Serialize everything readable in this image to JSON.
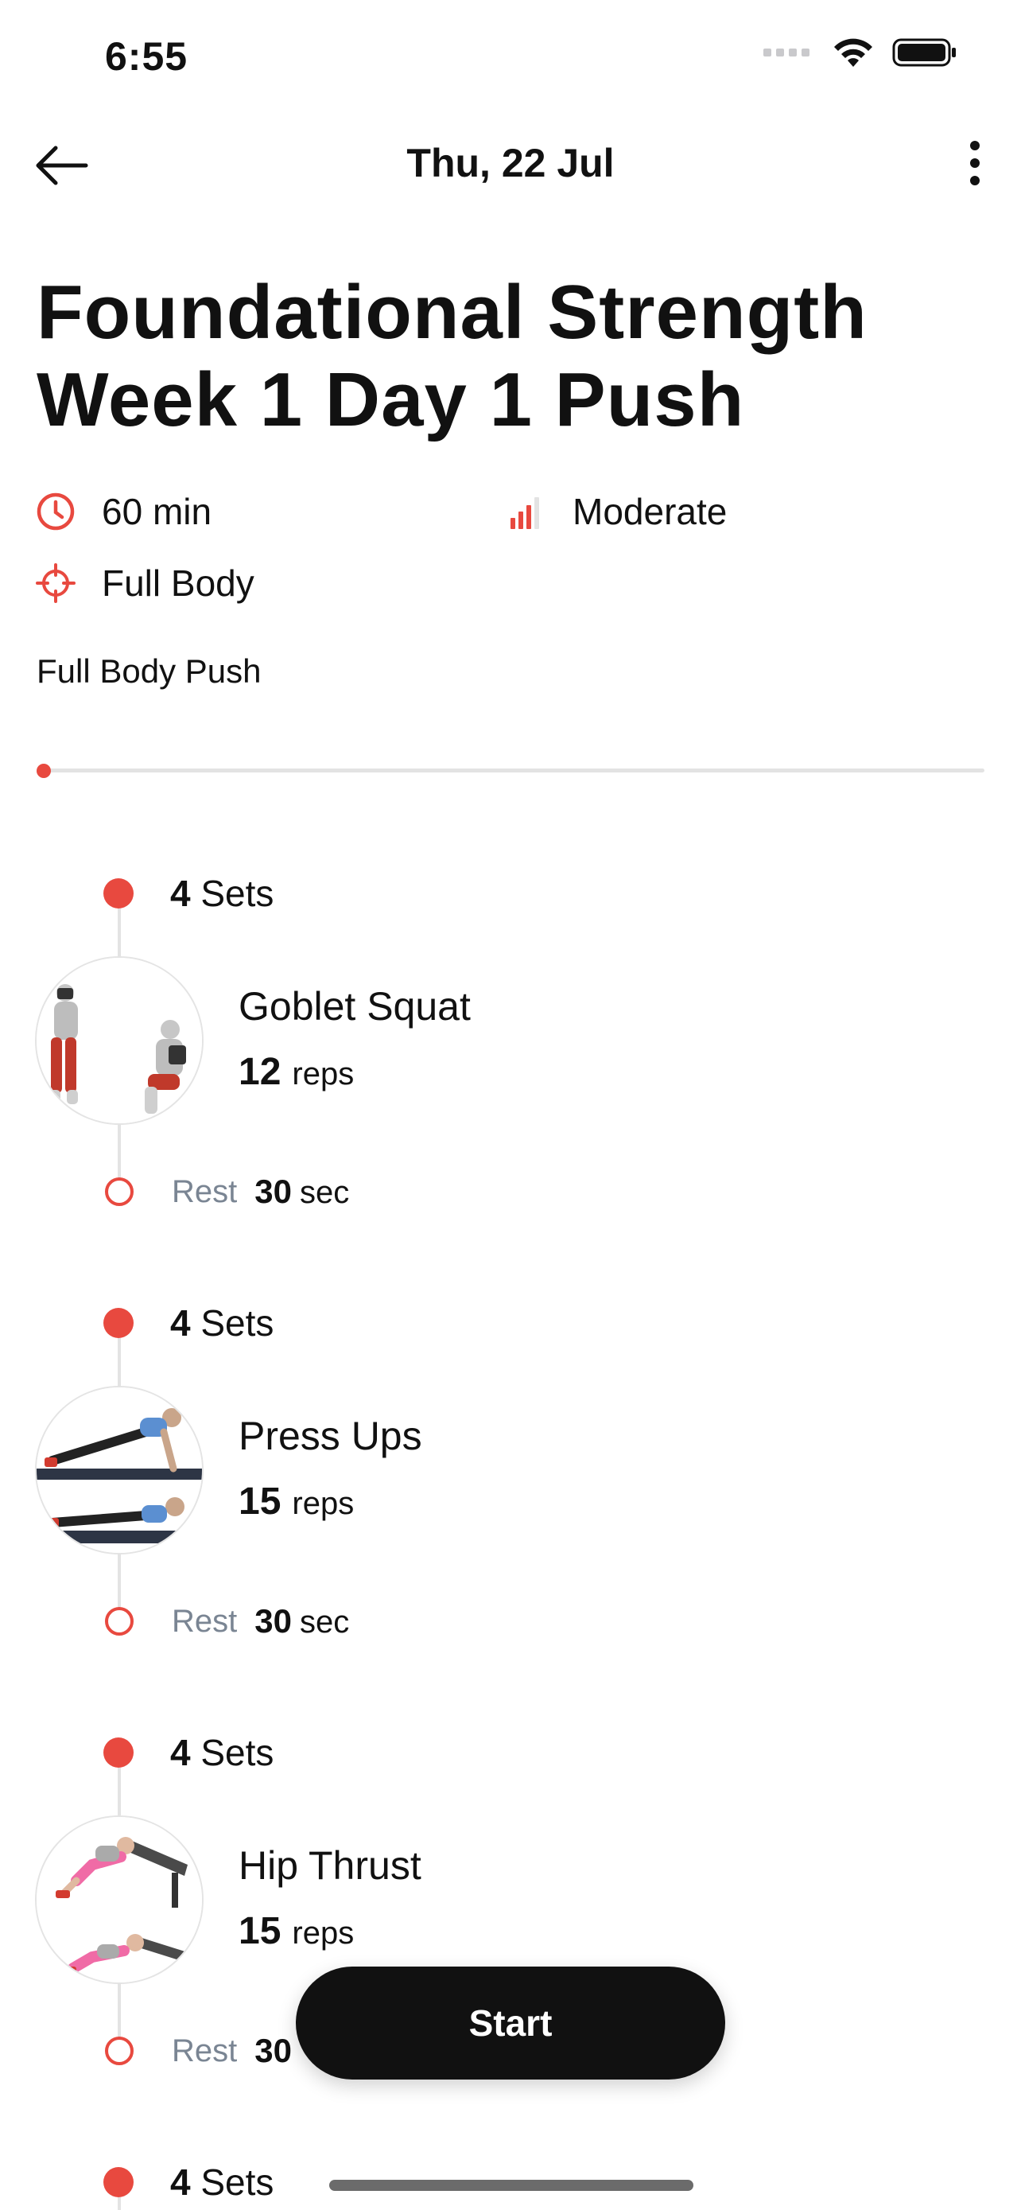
{
  "status_bar": {
    "time": "6:55"
  },
  "nav": {
    "title": "Thu, 22 Jul"
  },
  "workout": {
    "title_line1": "Foundational Strength",
    "title_line2": "Week 1 Day 1 Push",
    "duration": "60 min",
    "intensity": "Moderate",
    "focus": "Full Body",
    "description": "Full Body Push",
    "progress_fraction": 0.0
  },
  "exercises": [
    {
      "sets_count": "4",
      "sets_label": "Sets",
      "name": "Goblet Squat",
      "reps_count": "12",
      "reps_label": "reps",
      "rest_label": "Rest",
      "rest_value": "30",
      "rest_unit": "sec"
    },
    {
      "sets_count": "4",
      "sets_label": "Sets",
      "name": "Press Ups",
      "reps_count": "15",
      "reps_label": "reps",
      "rest_label": "Rest",
      "rest_value": "30",
      "rest_unit": "sec"
    },
    {
      "sets_count": "4",
      "sets_label": "Sets",
      "name": "Hip Thrust",
      "reps_count": "15",
      "reps_label": "reps",
      "rest_label": "Rest",
      "rest_value": "30",
      "rest_unit": ""
    },
    {
      "sets_count": "4",
      "sets_label": "Sets"
    }
  ],
  "actions": {
    "start_label": "Start"
  },
  "colors": {
    "accent": "#e8493f",
    "text": "#111111",
    "muted": "#7a8593",
    "button_bg": "#111111"
  },
  "icons": {
    "back": "arrow-left-icon",
    "more": "more-vertical-icon",
    "duration": "clock-icon",
    "intensity": "signal-bars-icon",
    "focus": "crosshair-icon"
  }
}
